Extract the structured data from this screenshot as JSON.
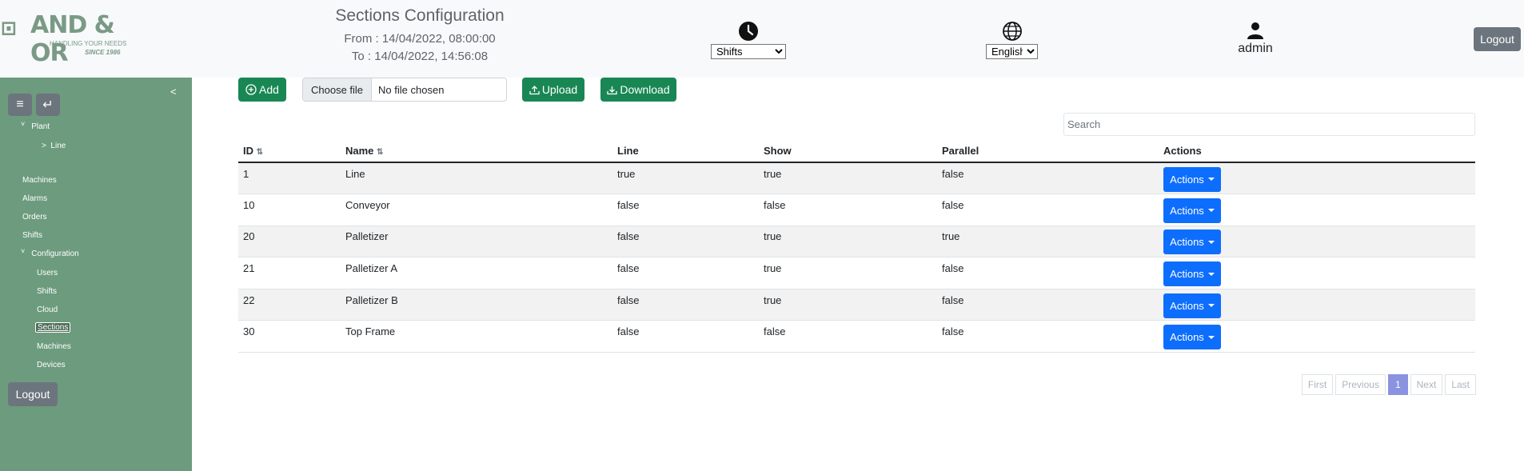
{
  "header": {
    "logo_brand": "AND & OR",
    "logo_tagline": "HANDLING YOUR NEEDS",
    "logo_since": "SINCE 1986",
    "title": "Sections Configuration",
    "from": "From : 14/04/2022, 08:00:00",
    "to": "To : 14/04/2022, 14:56:08",
    "shift_select": "Shifts",
    "language_select": "English",
    "username": "admin",
    "logout_label": "Logout"
  },
  "sidebar": {
    "collapse": "<",
    "menu_icon": "hamburger-icon",
    "back_icon": "return-icon",
    "items": {
      "plant": "Plant",
      "line": "Line",
      "machines": "Machines",
      "alarms": "Alarms",
      "orders": "Orders",
      "shifts": "Shifts",
      "configuration": "Configuration",
      "users": "Users",
      "config_shifts": "Shifts",
      "cloud": "Cloud",
      "sections": "Sections",
      "config_machines": "Machines",
      "devices": "Devices"
    },
    "logout_label": "Logout"
  },
  "toolbar": {
    "add_label": "Add",
    "choose_file": "Choose file",
    "no_file": "No file chosen",
    "upload_label": "Upload",
    "download_label": "Download",
    "search_placeholder": "Search"
  },
  "table": {
    "columns": {
      "id": "ID",
      "name": "Name",
      "line": "Line",
      "show": "Show",
      "parallel": "Parallel",
      "actions": "Actions"
    },
    "rows": [
      {
        "id": "1",
        "name": "Line",
        "line": "true",
        "show": "true",
        "parallel": "false",
        "action": "Actions"
      },
      {
        "id": "10",
        "name": "Conveyor",
        "line": "false",
        "show": "false",
        "parallel": "false",
        "action": "Actions"
      },
      {
        "id": "20",
        "name": "Palletizer",
        "line": "false",
        "show": "true",
        "parallel": "true",
        "action": "Actions"
      },
      {
        "id": "21",
        "name": "Palletizer A",
        "line": "false",
        "show": "true",
        "parallel": "false",
        "action": "Actions"
      },
      {
        "id": "22",
        "name": "Palletizer B",
        "line": "false",
        "show": "true",
        "parallel": "false",
        "action": "Actions"
      },
      {
        "id": "30",
        "name": "Top Frame",
        "line": "false",
        "show": "false",
        "parallel": "false",
        "action": "Actions"
      }
    ]
  },
  "pagination": {
    "first": "First",
    "previous": "Previous",
    "current": "1",
    "next": "Next",
    "last": "Last"
  },
  "colors": {
    "sidebar": "#6c9b7e",
    "primary": "#0d6efd",
    "success": "#198754",
    "secondary": "#6c757d"
  }
}
